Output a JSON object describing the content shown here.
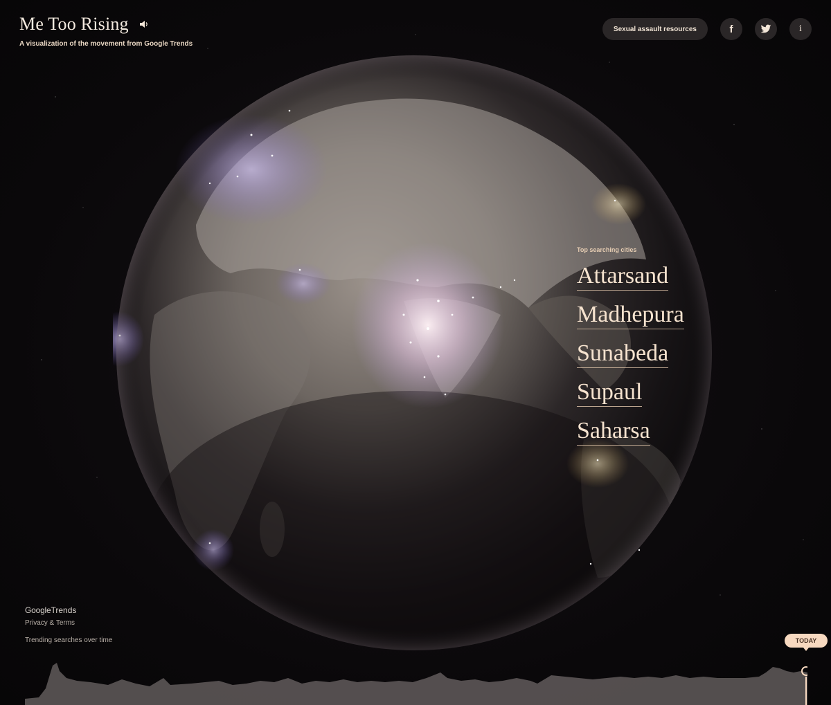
{
  "header": {
    "title": "Me Too Rising",
    "subtitle": "A visualization of the movement from Google Trends",
    "sound_icon": "speaker-icon"
  },
  "actions": {
    "resources_label": "Sexual assault resources",
    "facebook_icon": "f",
    "twitter_icon": "twitter-bird-icon",
    "info_icon": "i"
  },
  "cities": {
    "label": "Top searching cities",
    "items": [
      "Attarsand",
      "Madhepura",
      "Sunabeda",
      "Supaul",
      "Saharsa"
    ]
  },
  "footer": {
    "brand_google": "Google",
    "brand_trends": "Trends",
    "privacy": "Privacy & Terms",
    "trend_label": "Trending searches over time",
    "today_label": "TODAY"
  },
  "colors": {
    "accent": "#f7d9c0",
    "pill_bg": "#2a2627",
    "glow_purple": "#b49cff",
    "glow_gold": "#ffe3a6"
  }
}
